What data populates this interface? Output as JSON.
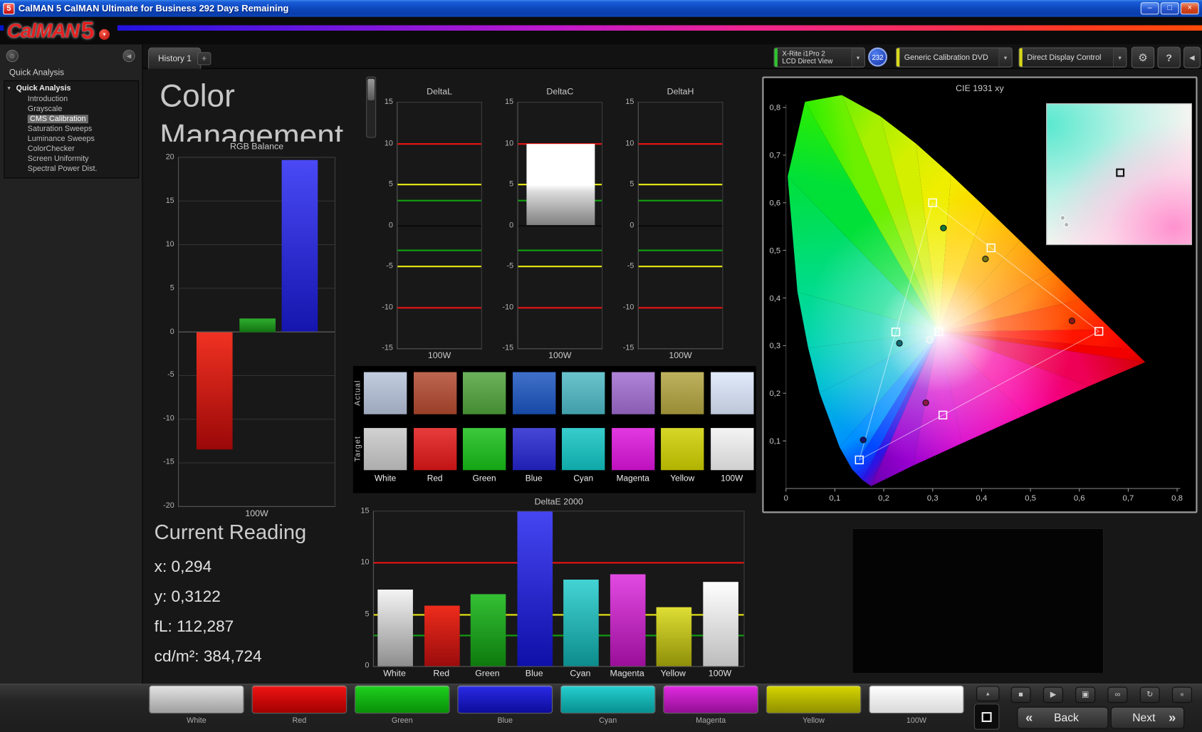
{
  "titlebar": {
    "icon": "5",
    "title": "CalMAN 5 CalMAN Ultimate for Business 292 Days Remaining",
    "minimize": "–",
    "maximize": "□",
    "close": "×"
  },
  "brand": {
    "logo_text": "CalMAN",
    "logo_number": "5",
    "dropdown": "▾"
  },
  "toolbar": {
    "meter_line1": "X-Rite i1Pro 2",
    "meter_line2": "LCD Direct View",
    "badge": "232",
    "pattern_source": "Generic Calibration DVD",
    "display_control": "Direct Display Control",
    "chevron": "▾",
    "gear": "⚙",
    "help": "?",
    "panel_toggle": "◀"
  },
  "tabs": {
    "history": "History 1",
    "add_tab": "+"
  },
  "sidebar": {
    "header": "Quick Analysis",
    "root_label": "Quick Analysis",
    "expand_glyph": "▾",
    "options_glyph": "⊙",
    "collapse_glyph": "◀",
    "items": [
      {
        "label": "Introduction",
        "selected": false
      },
      {
        "label": "Grayscale",
        "selected": false
      },
      {
        "label": "CMS Calibration",
        "selected": true
      },
      {
        "label": "Saturation Sweeps",
        "selected": false
      },
      {
        "label": "Luminance Sweeps",
        "selected": false
      },
      {
        "label": "ColorChecker",
        "selected": false
      },
      {
        "label": "Screen Uniformity",
        "selected": false
      },
      {
        "label": "Spectral Power Dist.",
        "selected": false
      }
    ]
  },
  "page": {
    "title_line1": "Color",
    "title_line2": "Management"
  },
  "reading": {
    "heading": "Current Reading",
    "lines": [
      "x: 0,294",
      "y: 0,3122",
      "fL: 112,287",
      "cd/m²: 384,724"
    ]
  },
  "swatch_table": {
    "row_labels": [
      "Actual",
      "Target"
    ],
    "columns": [
      "White",
      "Red",
      "Green",
      "Blue",
      "Cyan",
      "Magenta",
      "Yellow",
      "100W"
    ],
    "actual_colors": [
      "#b6c3da",
      "#b2492f",
      "#4fa33c",
      "#1b55c0",
      "#4cb8c4",
      "#a06cd0",
      "#b1a33f",
      "#dbe7fb"
    ],
    "target_colors": [
      "#c9c9c9",
      "#e21717",
      "#17bf17",
      "#2424cf",
      "#12c3c3",
      "#dc14dc",
      "#cfcf00",
      "#f2f2f2"
    ]
  },
  "transport": {
    "up_glyph": "▲",
    "buttons": [
      {
        "name": "stop",
        "glyph": "■"
      },
      {
        "name": "play",
        "glyph": "▶"
      },
      {
        "name": "pattern-window",
        "glyph": "▣"
      },
      {
        "name": "continuous-read",
        "glyph": "∞"
      },
      {
        "name": "loop",
        "glyph": "↻"
      },
      {
        "name": "record",
        "glyph": "●"
      }
    ],
    "back_glyph": "«",
    "back": "Back",
    "next": "Next",
    "next_glyph": "»"
  },
  "bottom_patterns": [
    {
      "label": "White",
      "c1": "#e2e2e2",
      "c2": "#9f9f9f"
    },
    {
      "label": "Red",
      "c1": "#f01414",
      "c2": "#a30000"
    },
    {
      "label": "Green",
      "c1": "#1ed01e",
      "c2": "#089008"
    },
    {
      "label": "Blue",
      "c1": "#2a2ae6",
      "c2": "#0c0c9a"
    },
    {
      "label": "Cyan",
      "c1": "#25cfcf",
      "c2": "#088f8f"
    },
    {
      "label": "Magenta",
      "c1": "#e02ae0",
      "c2": "#930f93"
    },
    {
      "label": "Yellow",
      "c1": "#d6d600",
      "c2": "#8f8f00"
    },
    {
      "label": "100W",
      "c1": "#ffffff",
      "c2": "#d8d8d8"
    }
  ],
  "chart_data": [
    {
      "id": "rgb_balance",
      "type": "bar",
      "title": "RGB Balance",
      "categories": [
        "Red",
        "Green",
        "Blue"
      ],
      "values": [
        -13.5,
        1.5,
        19.7
      ],
      "bar_gradients": [
        [
          "#f03222",
          "#9a0808"
        ],
        [
          "#2fae2f",
          "#127012"
        ],
        [
          "#4a4af6",
          "#1515ae"
        ]
      ],
      "xlabel": "100W",
      "ylim": [
        -20,
        20
      ],
      "yticks": [
        -20,
        -15,
        -10,
        -5,
        0,
        5,
        10,
        15,
        20
      ],
      "grid": true
    },
    {
      "id": "delta_l",
      "type": "bar",
      "title": "DeltaL",
      "categories": [
        "100W"
      ],
      "values": [
        0
      ],
      "bar_gradients": [
        [
          "#ffffff",
          "#7c7c7c"
        ]
      ],
      "xlabel": "100W",
      "ylim": [
        -15,
        15
      ],
      "yticks": [
        -15,
        -10,
        -5,
        0,
        5,
        10,
        15
      ],
      "reference_lines": [
        {
          "y": 10,
          "color": "#e81414"
        },
        {
          "y": -10,
          "color": "#e81414"
        },
        {
          "y": 5,
          "color": "#e8e814"
        },
        {
          "y": -5,
          "color": "#e8e814"
        },
        {
          "y": 3,
          "color": "#11a011"
        },
        {
          "y": -3,
          "color": "#11a011"
        }
      ]
    },
    {
      "id": "delta_c",
      "type": "bar",
      "title": "DeltaC",
      "categories": [
        "100W"
      ],
      "values": [
        10
      ],
      "bar_gradients": [
        [
          "#ffffff",
          "#7c7c7c"
        ]
      ],
      "xlabel": "100W",
      "ylim": [
        -15,
        15
      ],
      "yticks": [
        -15,
        -10,
        -5,
        0,
        5,
        10,
        15
      ],
      "reference_lines": [
        {
          "y": 10,
          "color": "#e81414"
        },
        {
          "y": -10,
          "color": "#e81414"
        },
        {
          "y": 5,
          "color": "#e8e814"
        },
        {
          "y": -5,
          "color": "#e8e814"
        },
        {
          "y": 3,
          "color": "#11a011"
        },
        {
          "y": -3,
          "color": "#11a011"
        }
      ]
    },
    {
      "id": "delta_h",
      "type": "bar",
      "title": "DeltaH",
      "categories": [
        "100W"
      ],
      "values": [
        0
      ],
      "bar_gradients": [
        [
          "#ffffff",
          "#7c7c7c"
        ]
      ],
      "xlabel": "100W",
      "ylim": [
        -15,
        15
      ],
      "yticks": [
        -15,
        -10,
        -5,
        0,
        5,
        10,
        15
      ],
      "reference_lines": [
        {
          "y": 10,
          "color": "#e81414"
        },
        {
          "y": -10,
          "color": "#e81414"
        },
        {
          "y": 5,
          "color": "#e8e814"
        },
        {
          "y": -5,
          "color": "#e8e814"
        },
        {
          "y": 3,
          "color": "#11a011"
        },
        {
          "y": -3,
          "color": "#11a011"
        }
      ]
    },
    {
      "id": "delta_e2000",
      "type": "bar",
      "title": "DeltaE 2000",
      "categories": [
        "White",
        "Red",
        "Green",
        "Blue",
        "Cyan",
        "Magenta",
        "Yellow",
        "100W"
      ],
      "values": [
        7.4,
        5.9,
        7.0,
        15.0,
        8.4,
        8.9,
        5.7,
        8.2
      ],
      "bar_gradients": [
        [
          "#f4f4f4",
          "#8e8e8e"
        ],
        [
          "#ee2c1c",
          "#9a0c0c"
        ],
        [
          "#34c034",
          "#0d7a0d"
        ],
        [
          "#4646f2",
          "#0f0fa8"
        ],
        [
          "#44d4d4",
          "#0d8c8c"
        ],
        [
          "#e24ae2",
          "#990f99"
        ],
        [
          "#dede34",
          "#8f8f0a"
        ],
        [
          "#ffffff",
          "#bcbcbc"
        ]
      ],
      "ylim": [
        0,
        15
      ],
      "yticks": [
        0,
        5,
        10,
        15
      ],
      "reference_lines": [
        {
          "y": 10,
          "color": "#e81414"
        },
        {
          "y": 5,
          "color": "#e8e814"
        },
        {
          "y": 3,
          "color": "#11a011"
        }
      ]
    },
    {
      "id": "cie_1931",
      "type": "scatter",
      "title": "CIE 1931 xy",
      "xlim": [
        0,
        0.8
      ],
      "ylim": [
        0,
        0.8
      ],
      "xtick_labels": [
        "0",
        "0,1",
        "0,2",
        "0,3",
        "0,4",
        "0,5",
        "0,6",
        "0,7",
        "0,8"
      ],
      "ytick_labels": [
        "0,1",
        "0,2",
        "0,3",
        "0,4",
        "0,5",
        "0,6",
        "0,7",
        "0,8"
      ],
      "targets": [
        {
          "name": "White",
          "x": 0.3127,
          "y": 0.329
        },
        {
          "name": "Red",
          "x": 0.64,
          "y": 0.33
        },
        {
          "name": "Green",
          "x": 0.3,
          "y": 0.6
        },
        {
          "name": "Blue",
          "x": 0.15,
          "y": 0.06
        },
        {
          "name": "Cyan",
          "x": 0.2246,
          "y": 0.3287
        },
        {
          "name": "Magenta",
          "x": 0.3209,
          "y": 0.1542
        },
        {
          "name": "Yellow",
          "x": 0.4193,
          "y": 0.5053
        }
      ],
      "measured": [
        {
          "name": "White",
          "x": 0.294,
          "y": 0.3122,
          "color": "none"
        },
        {
          "name": "Red",
          "x": 0.585,
          "y": 0.352,
          "color": "#8c1616"
        },
        {
          "name": "Green",
          "x": 0.322,
          "y": 0.547,
          "color": "#117a33"
        },
        {
          "name": "Blue",
          "x": 0.158,
          "y": 0.102,
          "color": "#14146e"
        },
        {
          "name": "Cyan",
          "x": 0.232,
          "y": 0.305,
          "color": "#0e6a72"
        },
        {
          "name": "Magenta",
          "x": 0.286,
          "y": 0.18,
          "color": "#8c1848"
        },
        {
          "name": "Yellow",
          "x": 0.408,
          "y": 0.482,
          "color": "#737311"
        }
      ]
    }
  ]
}
